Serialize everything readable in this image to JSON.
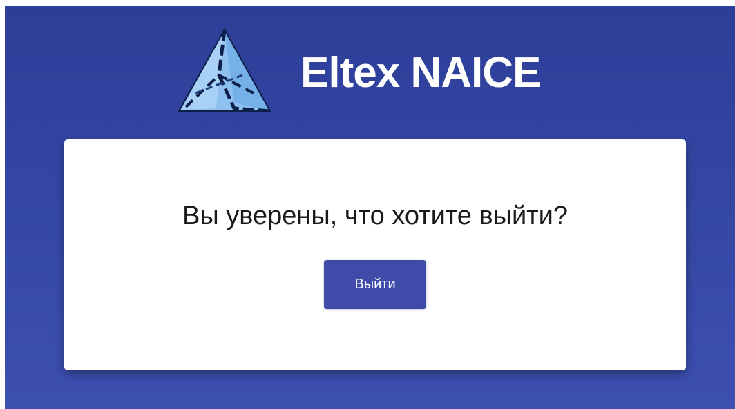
{
  "header": {
    "logo_icon": "eltex-triangle-logo-icon",
    "app_title": "Eltex NAICE"
  },
  "dialog": {
    "question": "Вы уверены, что хотите выйти?",
    "logout_label": "Выйти"
  },
  "colors": {
    "background": "#3342a2",
    "button": "#3f4ba8",
    "card": "#ffffff",
    "logo_light": "#8ec1f0",
    "logo_dark": "#0e1f4a"
  }
}
